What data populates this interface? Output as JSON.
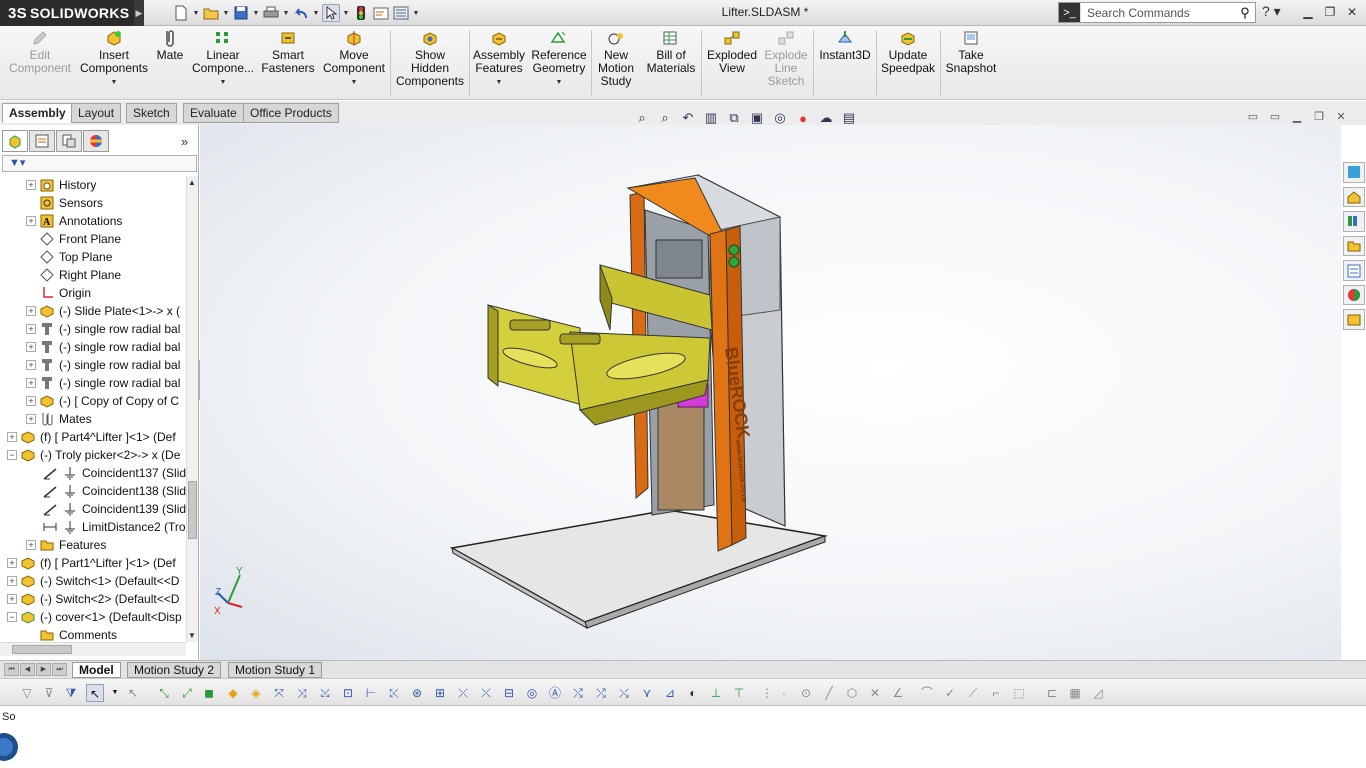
{
  "app": {
    "logo_text": "SOLIDWORKS",
    "logo_mark": "3S",
    "doc_title": "Lifter.SLDASM *"
  },
  "search": {
    "placeholder": "Search Commands"
  },
  "ribbon": [
    {
      "label": "Edit\nComponent",
      "disabled": true
    },
    {
      "label": "Insert\nComponents",
      "disabled": false
    },
    {
      "label": "Mate",
      "disabled": false
    },
    {
      "label": "Linear\nCompone...",
      "disabled": false
    },
    {
      "label": "Smart\nFasteners",
      "disabled": false
    },
    {
      "label": "Move\nComponent",
      "disabled": false
    },
    {
      "label": "Show\nHidden\nComponents",
      "disabled": false
    },
    {
      "label": "Assembly\nFeatures",
      "disabled": false
    },
    {
      "label": "Reference\nGeometry",
      "disabled": false
    },
    {
      "label": "New\nMotion\nStudy",
      "disabled": false
    },
    {
      "label": "Bill of\nMaterials",
      "disabled": false
    },
    {
      "label": "Exploded\nView",
      "disabled": false
    },
    {
      "label": "Explode\nLine\nSketch",
      "disabled": true
    },
    {
      "label": "Instant3D",
      "disabled": false
    },
    {
      "label": "Update\nSpeedpak",
      "disabled": false
    },
    {
      "label": "Take\nSnapshot",
      "disabled": false
    }
  ],
  "command_tabs": [
    "Assembly",
    "Layout",
    "Sketch",
    "Evaluate",
    "Office Products"
  ],
  "tree": [
    {
      "label": "History",
      "icon": "history-icon"
    },
    {
      "label": "Sensors",
      "icon": "sensor-icon"
    },
    {
      "label": "Annotations",
      "icon": "annotation-icon"
    },
    {
      "label": "Front Plane",
      "icon": "plane-icon"
    },
    {
      "label": "Top Plane",
      "icon": "plane-icon"
    },
    {
      "label": "Right Plane",
      "icon": "plane-icon"
    },
    {
      "label": "Origin",
      "icon": "origin-icon"
    },
    {
      "label": "(-) Slide Plate<1>-> x (",
      "icon": "part-icon"
    },
    {
      "label": "(-) single row radial bal",
      "icon": "bearing-icon"
    },
    {
      "label": "(-) single row radial bal",
      "icon": "bearing-icon"
    },
    {
      "label": "(-) single row radial bal",
      "icon": "bearing-icon"
    },
    {
      "label": "(-) single row radial bal",
      "icon": "bearing-icon"
    },
    {
      "label": "(-) [ Copy of Copy of C",
      "icon": "part-icon"
    },
    {
      "label": "Mates",
      "icon": "mates-icon"
    },
    {
      "label": "(f) [ Part4^Lifter ]<1> (Def",
      "icon": "part-icon"
    },
    {
      "label": "(-) Troly picker<2>-> x (De",
      "icon": "part-icon"
    },
    {
      "label": "Coincident137 (Slid",
      "icon": "coincident-icon"
    },
    {
      "label": "Coincident138 (Slid",
      "icon": "coincident-icon"
    },
    {
      "label": "Coincident139 (Slid",
      "icon": "coincident-icon"
    },
    {
      "label": "LimitDistance2 (Tro",
      "icon": "distance-icon"
    },
    {
      "label": "Features",
      "icon": "folder-icon"
    },
    {
      "label": "(f) [ Part1^Lifter ]<1> (Def",
      "icon": "part-icon"
    },
    {
      "label": "(-) Switch<1> (Default<<D",
      "icon": "part-icon"
    },
    {
      "label": "(-) Switch<2> (Default<<D",
      "icon": "part-icon"
    },
    {
      "label": "(-) cover<1> (Default<Disp",
      "icon": "part-icon"
    },
    {
      "label": "Comments",
      "icon": "folder-icon"
    }
  ],
  "bottom_tabs": [
    "Model",
    "Motion Study 2",
    "Motion Study 1"
  ],
  "model_text": {
    "brand": "BlueROCK",
    "url": "www.bluerock.co.za"
  },
  "triad": {
    "x": "X",
    "y": "Y",
    "z": "Z"
  },
  "status": {
    "text": "So"
  }
}
